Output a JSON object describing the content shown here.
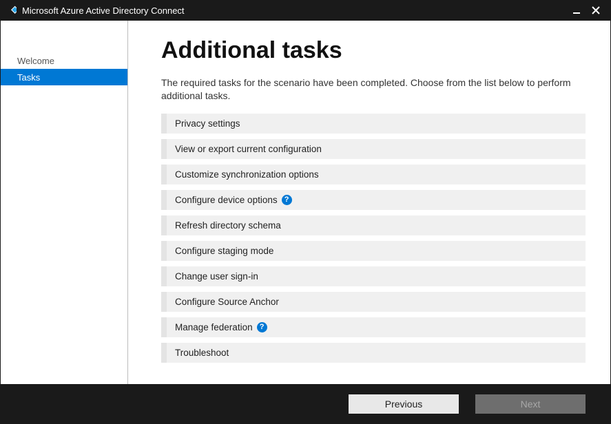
{
  "window": {
    "title": "Microsoft Azure Active Directory Connect"
  },
  "sidebar": {
    "items": [
      {
        "label": "Welcome",
        "active": false
      },
      {
        "label": "Tasks",
        "active": true
      }
    ]
  },
  "main": {
    "title": "Additional tasks",
    "description": "The required tasks for the scenario have been completed. Choose from the list below to perform additional tasks.",
    "tasks": [
      {
        "label": "Privacy settings",
        "help": false
      },
      {
        "label": "View or export current configuration",
        "help": false
      },
      {
        "label": "Customize synchronization options",
        "help": false
      },
      {
        "label": "Configure device options",
        "help": true
      },
      {
        "label": "Refresh directory schema",
        "help": false
      },
      {
        "label": "Configure staging mode",
        "help": false
      },
      {
        "label": "Change user sign-in",
        "help": false
      },
      {
        "label": "Configure Source Anchor",
        "help": false
      },
      {
        "label": "Manage federation",
        "help": true
      },
      {
        "label": "Troubleshoot",
        "help": false
      }
    ]
  },
  "footer": {
    "previous": "Previous",
    "next": "Next"
  }
}
